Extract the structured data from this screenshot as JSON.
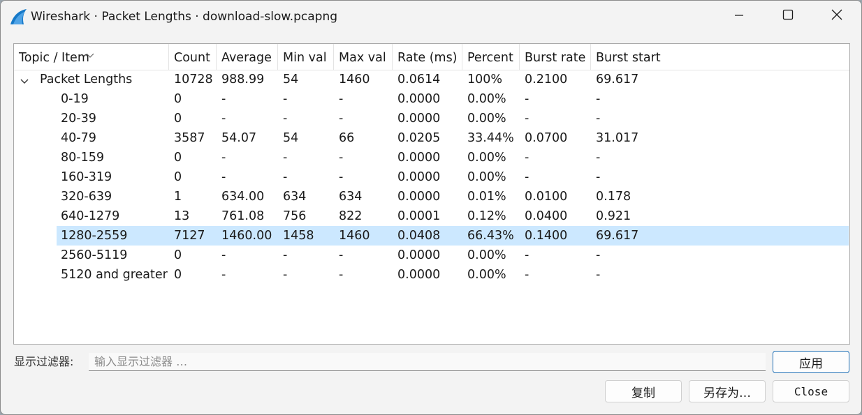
{
  "window": {
    "title": "Wireshark · Packet Lengths · download-slow.pcapng",
    "icon": "wireshark-fin-icon",
    "controls": [
      "minimize-icon",
      "maximize-icon",
      "close-icon"
    ]
  },
  "table": {
    "columns": [
      "Topic / Item",
      "Count",
      "Average",
      "Min val",
      "Max val",
      "Rate (ms)",
      "Percent",
      "Burst rate",
      "Burst start"
    ],
    "root": {
      "label": "Packet Lengths",
      "cells": [
        "10728",
        "988.99",
        "54",
        "1460",
        "0.0614",
        "100%",
        "0.2100",
        "69.617"
      ],
      "expanded": true
    },
    "rows": [
      {
        "label": "0-19",
        "cells": [
          "0",
          "-",
          "-",
          "-",
          "0.0000",
          "0.00%",
          "-",
          "-"
        ]
      },
      {
        "label": "20-39",
        "cells": [
          "0",
          "-",
          "-",
          "-",
          "0.0000",
          "0.00%",
          "-",
          "-"
        ]
      },
      {
        "label": "40-79",
        "cells": [
          "3587",
          "54.07",
          "54",
          "66",
          "0.0205",
          "33.44%",
          "0.0700",
          "31.017"
        ]
      },
      {
        "label": "80-159",
        "cells": [
          "0",
          "-",
          "-",
          "-",
          "0.0000",
          "0.00%",
          "-",
          "-"
        ]
      },
      {
        "label": "160-319",
        "cells": [
          "0",
          "-",
          "-",
          "-",
          "0.0000",
          "0.00%",
          "-",
          "-"
        ]
      },
      {
        "label": "320-639",
        "cells": [
          "1",
          "634.00",
          "634",
          "634",
          "0.0000",
          "0.01%",
          "0.0100",
          "0.178"
        ]
      },
      {
        "label": "640-1279",
        "cells": [
          "13",
          "761.08",
          "756",
          "822",
          "0.0001",
          "0.12%",
          "0.0400",
          "0.921"
        ]
      },
      {
        "label": "1280-2559",
        "cells": [
          "7127",
          "1460.00",
          "1458",
          "1460",
          "0.0408",
          "66.43%",
          "0.1400",
          "69.617"
        ],
        "selected": true
      },
      {
        "label": "2560-5119",
        "cells": [
          "0",
          "-",
          "-",
          "-",
          "0.0000",
          "0.00%",
          "-",
          "-"
        ]
      },
      {
        "label": "5120 and greater",
        "cells": [
          "0",
          "-",
          "-",
          "-",
          "0.0000",
          "0.00%",
          "-",
          "-"
        ]
      }
    ],
    "selection_color": "#cce8ff"
  },
  "filter": {
    "label": "显示过滤器:",
    "placeholder": "输入显示过滤器 …",
    "value": ""
  },
  "buttons": {
    "apply": "应用",
    "copy": "复制",
    "save_as": "另存为…",
    "close": "Close"
  },
  "colors": {
    "accent": "#1f6fb5",
    "window_bg": "#f3f3f3",
    "table_bg": "#ffffff"
  }
}
